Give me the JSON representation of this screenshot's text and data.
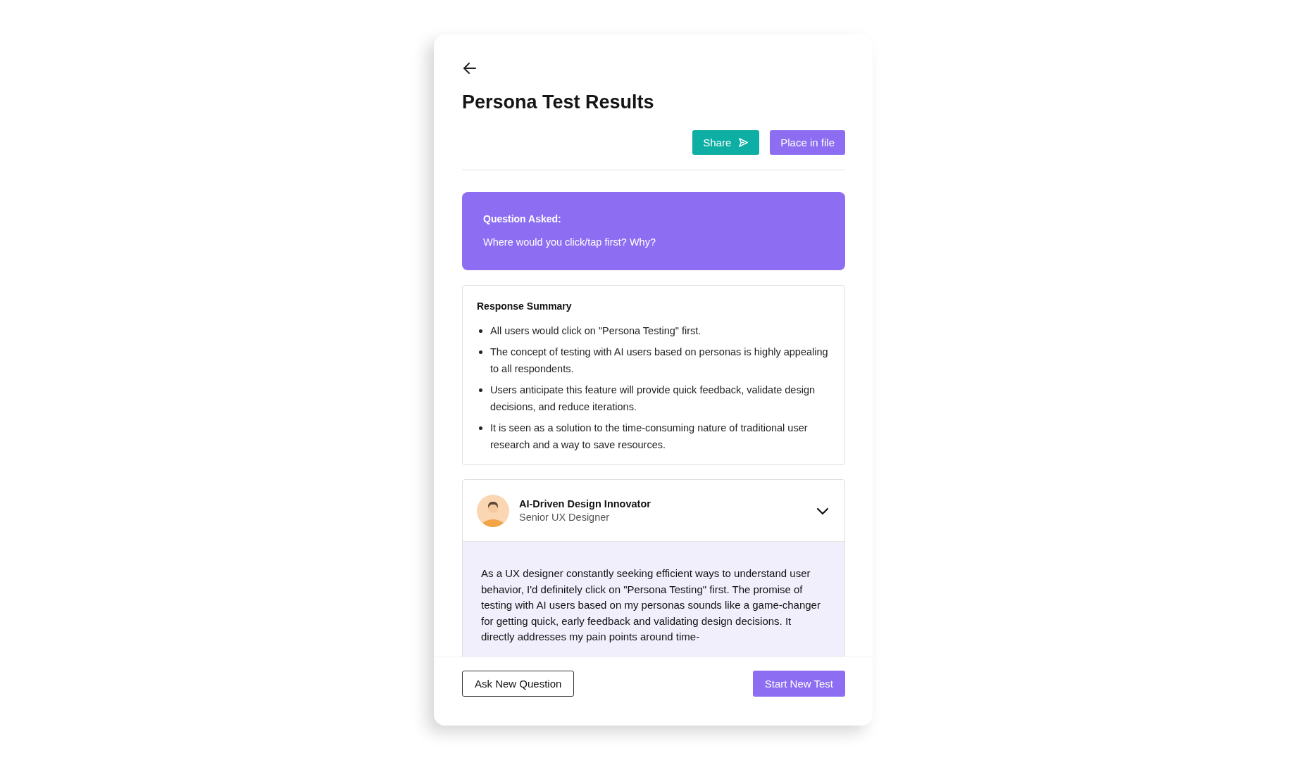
{
  "header": {
    "title": "Persona Test Results"
  },
  "actions": [
    {
      "label": "Share",
      "kind": "share"
    },
    {
      "label": "Place in file",
      "kind": "plain"
    }
  ],
  "question": {
    "heading": "Question Asked:",
    "text": "Where would you click/tap first? Why?"
  },
  "summary": {
    "heading": "Response Summary",
    "points": [
      "All users would click on \"Persona Testing\" first.",
      "The concept of testing with AI users based on personas is highly appealing to all respondents.",
      "Users anticipate this feature will provide quick feedback, validate design decisions, and reduce iterations.",
      "It is seen as a solution to the time-consuming nature of traditional user research and a way to save resources."
    ]
  },
  "personas": [
    {
      "name": "AI-Driven Design Innovator",
      "role": "Senior UX Designer",
      "expanded": true,
      "response": "As a UX designer constantly seeking efficient ways to understand user behavior, I'd definitely click on \"Persona Testing\" first. The promise of testing with AI users based on my personas sounds like a game-changer for getting quick, early feedback and validating design decisions. It directly addresses my pain points around time-"
    }
  ],
  "footer": [
    {
      "label": "Ask New Question",
      "kind": "outline"
    },
    {
      "label": "Start New Test",
      "kind": "primary"
    }
  ]
}
